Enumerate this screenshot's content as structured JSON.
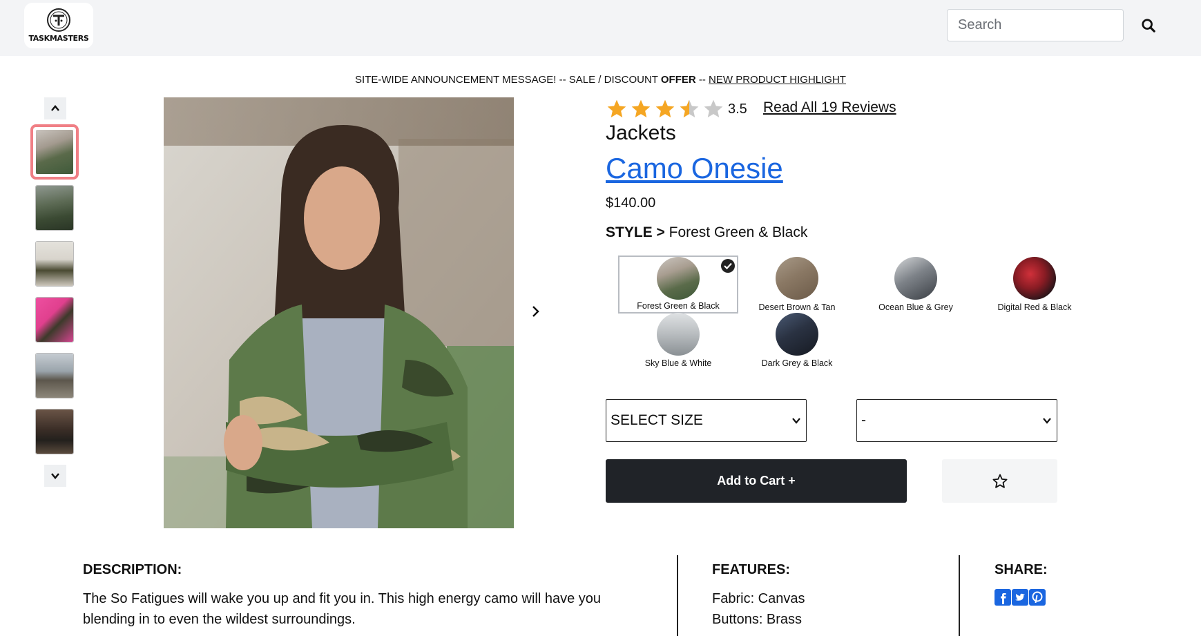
{
  "header": {
    "logo_text": "TASKMASTERS",
    "search_placeholder": "Search"
  },
  "announcement": {
    "text1": "SITE-WIDE ANNOUNCEMENT MESSAGE! -- SALE / DISCOUNT ",
    "bold": "OFFER",
    "text2": " -- ",
    "link": "NEW PRODUCT HIGHLIGHT"
  },
  "gallery": {
    "thumbnails": [
      {
        "name": "thumb-1",
        "selected": true
      },
      {
        "name": "thumb-2",
        "selected": false
      },
      {
        "name": "thumb-3",
        "selected": false
      },
      {
        "name": "thumb-4",
        "selected": false
      },
      {
        "name": "thumb-5",
        "selected": false
      },
      {
        "name": "thumb-6",
        "selected": false
      }
    ]
  },
  "product": {
    "rating": "3.5",
    "rating_value": 3.5,
    "rating_max": 5,
    "reviews_link": "Read All 19 Reviews",
    "category": "Jackets",
    "name": "Camo Onesie",
    "price": "$140.00",
    "style_label": "STYLE >",
    "style_value": "Forest Green & Black",
    "styles": [
      {
        "label": "Forest Green & Black",
        "selected": true
      },
      {
        "label": "Desert Brown & Tan",
        "selected": false
      },
      {
        "label": "Ocean Blue & Grey",
        "selected": false
      },
      {
        "label": "Digital Red & Black",
        "selected": false
      },
      {
        "label": "Sky Blue & White",
        "selected": false
      },
      {
        "label": "Dark Grey & Black",
        "selected": false
      }
    ],
    "size_select": "SELECT SIZE",
    "qty_select": "-",
    "add_to_cart": "Add to Cart +"
  },
  "info": {
    "description_head": "DESCRIPTION:",
    "description_line1": "The So Fatigues will wake you up and fit you in. This high energy camo will have you",
    "description_line2": "blending in to even the wildest surroundings.",
    "features_head": "FEATURES:",
    "features": [
      "Fabric: Canvas",
      "Buttons: Brass"
    ],
    "share_head": "SHARE:"
  },
  "colors": {
    "header_bg": "#f3f4f6",
    "link_blue": "#1a66e0",
    "cart_bg": "#202328",
    "star": "#f5a623",
    "selected_thumb_border": "#f07f85"
  },
  "icons": [
    "search-icon",
    "chevron-up-icon",
    "chevron-down-icon",
    "chevron-right-icon",
    "star-icon",
    "check-icon",
    "facebook-icon",
    "twitter-icon",
    "pinterest-icon"
  ]
}
